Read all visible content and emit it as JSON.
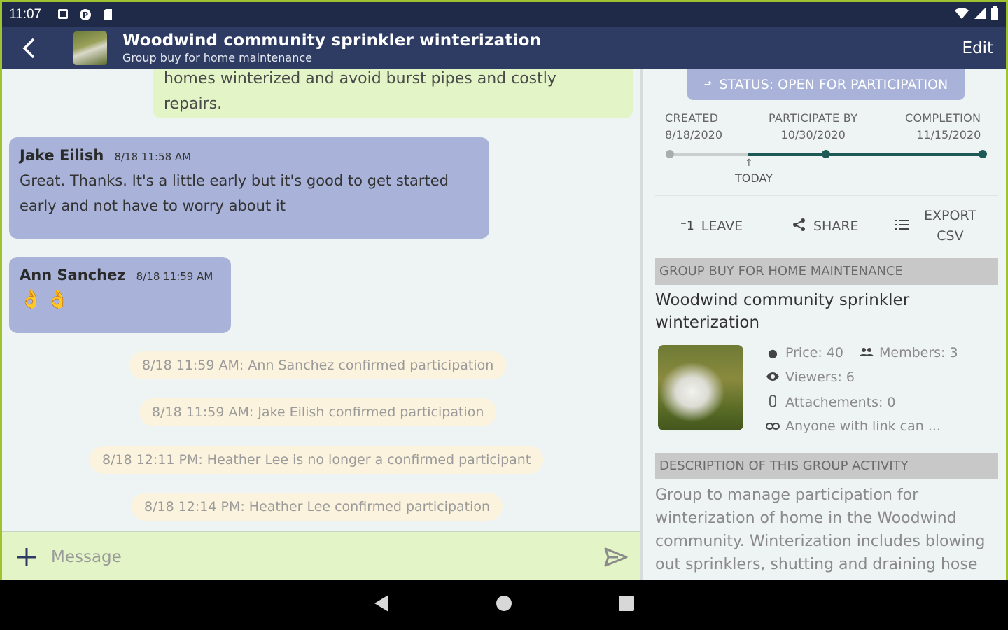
{
  "status_bar": {
    "time": "11:07"
  },
  "header": {
    "title": "Woodwind community sprinkler winterization",
    "subtitle": "Group buy for home maintenance",
    "edit_label": "Edit"
  },
  "chat": {
    "own_message": {
      "text_line1": "homes winterized and avoid burst pipes and costly",
      "text_line2": "repairs."
    },
    "messages": [
      {
        "author": "Jake Eilish",
        "time": "8/18 11:58 AM",
        "text_line1": "Great. Thanks. It's a little early but it's good to get started",
        "text_line2": "early and not have to worry about it"
      },
      {
        "author": "Ann Sanchez",
        "time": "8/18 11:59 AM",
        "text": "👌👌"
      }
    ],
    "system_events": [
      "8/18 11:59 AM: Ann Sanchez confirmed participation",
      "8/18 11:59 AM: Jake Eilish confirmed participation",
      "8/18 12:11 PM: Heather Lee is no longer a confirmed participant",
      "8/18 12:14 PM: Heather Lee confirmed participation"
    ],
    "composer_placeholder": "Message"
  },
  "panel": {
    "status": "STATUS: OPEN FOR PARTICIPATION",
    "dates": {
      "created_label": "CREATED",
      "created_value": "8/18/2020",
      "participate_label": "PARTICIPATE BY",
      "participate_value": "10/30/2020",
      "completion_label": "COMPLETION",
      "completion_value": "11/15/2020",
      "today_label": "TODAY"
    },
    "actions": {
      "leave": "LEAVE",
      "share": "SHARE",
      "export_line1": "EXPORT",
      "export_line2": "CSV"
    },
    "group_section_title": "GROUP BUY FOR HOME MAINTENANCE",
    "group_title_line1": "Woodwind community sprinkler",
    "group_title_line2": "winterization",
    "stats": {
      "price": "Price: 40",
      "members": "Members: 3",
      "viewers": "Viewers: 6",
      "attachments": "Attachements: 0",
      "link_access": "Anyone with link can ..."
    },
    "description_section_title": "DESCRIPTION OF THIS GROUP ACTIVITY",
    "description_lines": [
      "Group to manage participation for",
      "winterization of home in the Woodwind",
      "community. Winterization includes blowing",
      "out sprinklers, shutting and draining hose"
    ]
  },
  "colors": {
    "app_bar": "#2e3c63",
    "status_bar": "#1f2a48",
    "incoming_bubble": "#a9b3d9",
    "outgoing_bubble": "#e3f4c6",
    "system_event": "#fbf3dd",
    "timeline_active": "#1d5a57"
  }
}
